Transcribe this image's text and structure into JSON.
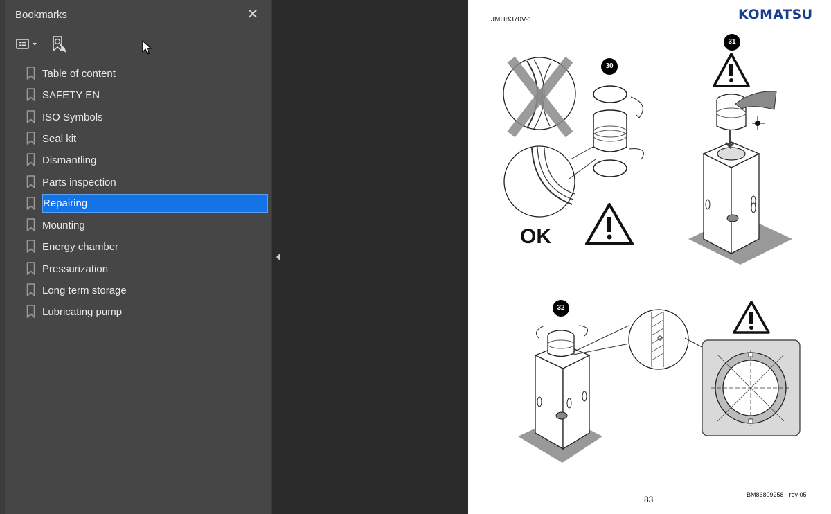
{
  "panel": {
    "title": "Bookmarks",
    "close_glyph": "✕",
    "toolbar": {
      "options_icon": "list-options-icon",
      "find_icon": "find-bookmark-icon"
    }
  },
  "bookmarks": {
    "items": [
      {
        "label": "Table of content",
        "selected": false
      },
      {
        "label": "SAFETY EN",
        "selected": false
      },
      {
        "label": "ISO Symbols",
        "selected": false
      },
      {
        "label": "Seal kit",
        "selected": false
      },
      {
        "label": "Dismantling",
        "selected": false
      },
      {
        "label": "Parts inspection",
        "selected": false
      },
      {
        "label": "Repairing",
        "selected": true
      },
      {
        "label": "Mounting",
        "selected": false
      },
      {
        "label": "Energy chamber",
        "selected": false
      },
      {
        "label": "Pressurization",
        "selected": false
      },
      {
        "label": "Long term storage",
        "selected": false
      },
      {
        "label": "Lubricating pump",
        "selected": false
      }
    ]
  },
  "document": {
    "doc_id": "JMHB370V-1",
    "brand": "KOMATSU",
    "page_number": "83",
    "doc_ref": "BM86809258 - rev 05",
    "steps": [
      "30",
      "31",
      "32"
    ],
    "ok_label": "OK"
  },
  "colors": {
    "panel_bg": "#464646",
    "selection": "#1473e6",
    "brand": "#1a3e8c"
  }
}
